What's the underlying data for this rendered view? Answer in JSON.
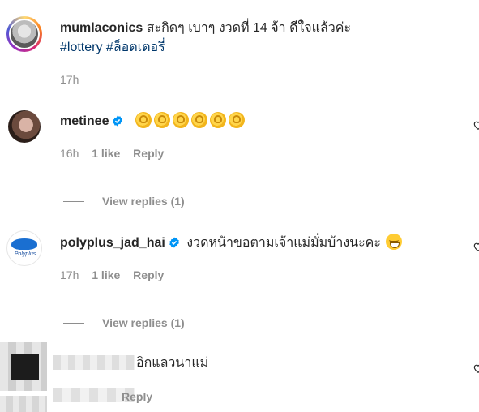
{
  "caption": {
    "username": "mumlaconics",
    "text": "สะกิดๆ เบาๆ งวดที่ 14 จ้า ดีใจแล้วค่ะ",
    "hashtags": [
      "#lottery",
      "#ล็อตเตอรี่"
    ],
    "time": "17h"
  },
  "comments": [
    {
      "username": "metinee",
      "verified": true,
      "text": "",
      "emoji": "clapping-hands x6",
      "time": "16h",
      "likes": "1 like",
      "reply_label": "Reply",
      "view_replies": "View replies (1)"
    },
    {
      "username": "polyplus_jad_hai",
      "verified": true,
      "text": "งวดหน้าขอตามเจ้าแม่มั่มบ้างนะคะ",
      "emoji": "grinning-sweat",
      "avatar_caption": "Polyplus",
      "time": "17h",
      "likes": "1 like",
      "reply_label": "Reply",
      "view_replies": "View replies (1)"
    },
    {
      "username": "",
      "text": "อิกแลวนาแม่",
      "reply_label": "Reply"
    }
  ],
  "colors": {
    "text": "#262626",
    "secondary": "#8e8e8e",
    "hashtag": "#00376b",
    "verified": "#0095f6"
  }
}
